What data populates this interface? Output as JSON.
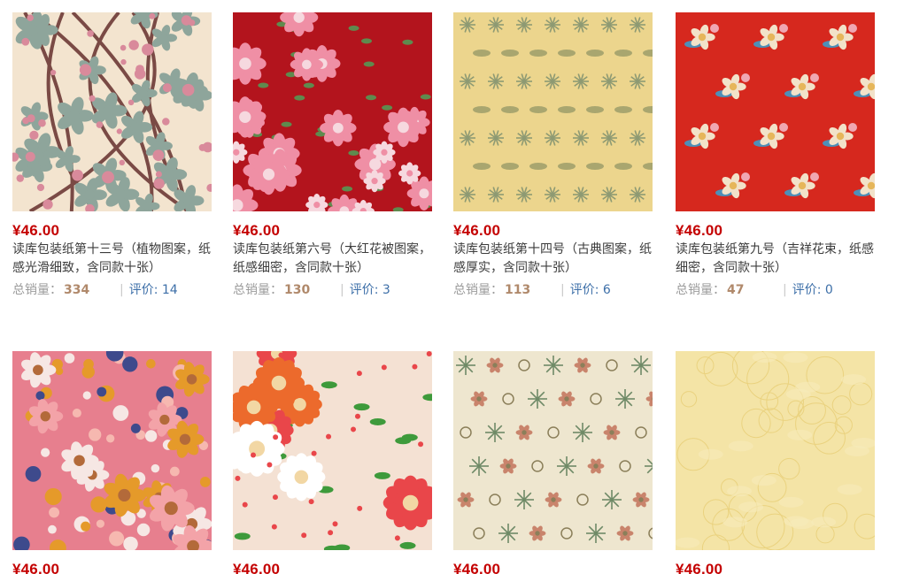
{
  "products": [
    {
      "price": "¥46.00",
      "title": "读库包装纸第十三号（植物图案，纸感光滑细致，含同款十张）",
      "sales_label": "总销量：",
      "sales": "334",
      "reviews_label": "评价: ",
      "reviews": "14",
      "pattern": "leaves-pink",
      "colors": {
        "bg": "#f3e4cf",
        "a": "#8ea59b",
        "b": "#d98a9b",
        "c": "#7a4a45"
      }
    },
    {
      "price": "¥46.00",
      "title": "读库包装纸第六号（大红花被图案，纸感细密，含同款十张）",
      "sales_label": "总销量：",
      "sales": "130",
      "reviews_label": "评价: ",
      "reviews": "3",
      "pattern": "peony-red",
      "colors": {
        "bg": "#b3141d",
        "a": "#ef8fa5",
        "b": "#f6d9df",
        "c": "#5f8a4e"
      }
    },
    {
      "price": "¥46.00",
      "title": "读库包装纸第十四号（古典图案，纸感厚实，含同款十张）",
      "sales_label": "总销量：",
      "sales": "113",
      "reviews_label": "评价: ",
      "reviews": "6",
      "pattern": "classic-yellow",
      "colors": {
        "bg": "#ecd58d",
        "a": "#a9a66f",
        "b": "#c7b875",
        "c": "#8e9a73"
      }
    },
    {
      "price": "¥46.00",
      "title": "读库包装纸第九号（吉祥花束，纸感细密，含同款十张）",
      "sales_label": "总销量：",
      "sales": "47",
      "reviews_label": "评价: ",
      "reviews": "0",
      "pattern": "bouquet-red",
      "colors": {
        "bg": "#d6281e",
        "a": "#f2e2c9",
        "b": "#4d8fb8",
        "c": "#f0a7b2"
      }
    },
    {
      "price": "¥46.00",
      "pattern": "dense-pink",
      "colors": {
        "bg": "#e77f8e",
        "a": "#f6e7e4",
        "b": "#e59a2a",
        "c": "#3e4a8c"
      }
    },
    {
      "price": "¥46.00",
      "pattern": "chrysanthemum",
      "colors": {
        "bg": "#f4e1d3",
        "a": "#ec6a2c",
        "b": "#e9464a",
        "c": "#3e9a3b"
      }
    },
    {
      "price": "¥46.00",
      "pattern": "botanical-cream",
      "colors": {
        "bg": "#eee6cf",
        "a": "#8b7f5a",
        "b": "#c9846c",
        "c": "#6f8a67"
      }
    },
    {
      "price": "¥46.00",
      "pattern": "plain-yellow",
      "colors": {
        "bg": "#f4e4a6",
        "a": "#efd98e",
        "b": "#f7ebbb",
        "c": "#ead27f"
      }
    }
  ]
}
